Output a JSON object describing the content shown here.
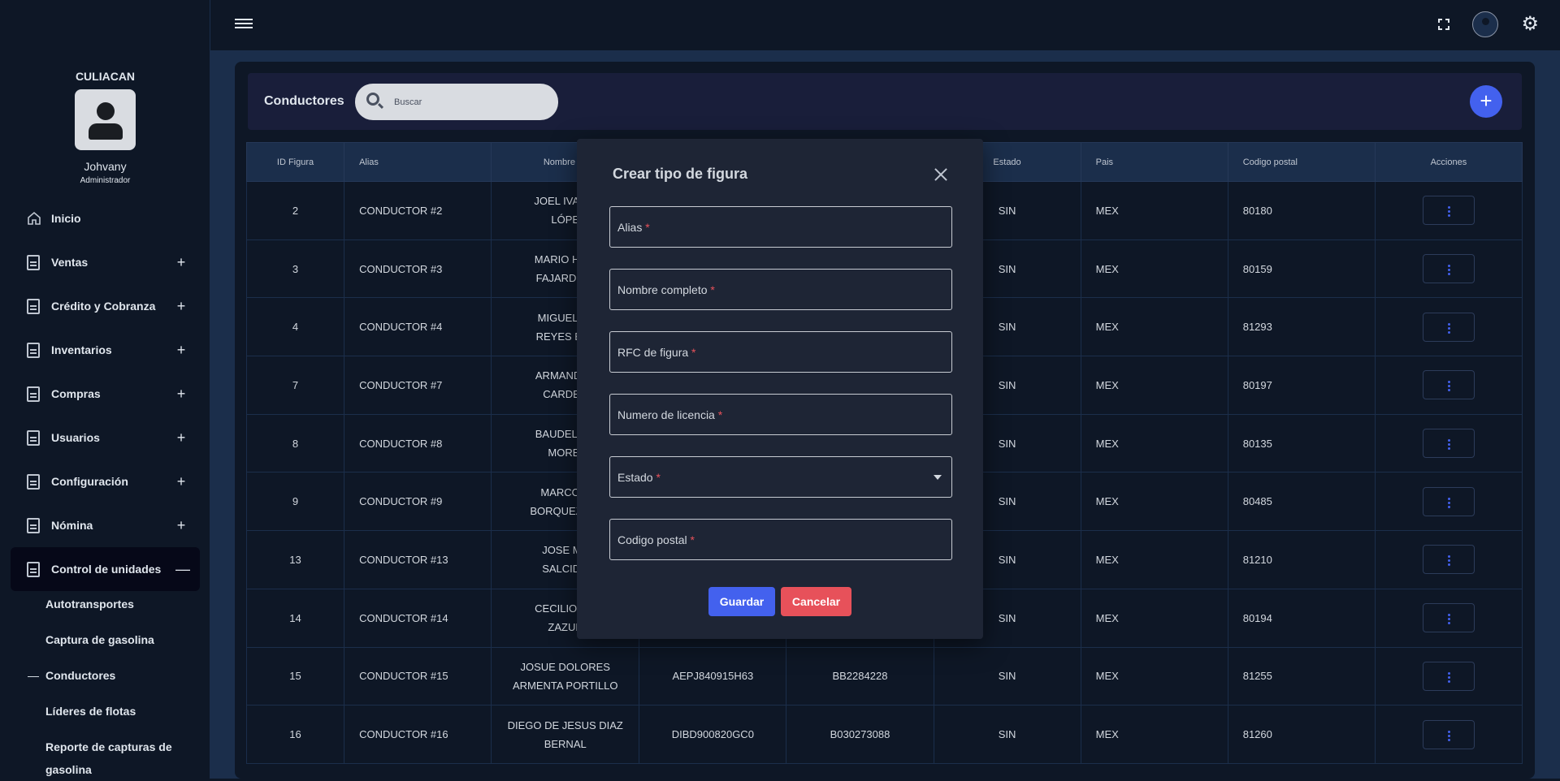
{
  "sidebar": {
    "brand": "CULIACAN",
    "user_name": "Johvany",
    "user_role": "Administrador",
    "items": [
      {
        "label": "Inicio",
        "toggle": ""
      },
      {
        "label": "Ventas",
        "toggle": "+"
      },
      {
        "label": "Crédito y Cobranza",
        "toggle": "+"
      },
      {
        "label": "Inventarios",
        "toggle": "+"
      },
      {
        "label": "Compras",
        "toggle": "+"
      },
      {
        "label": "Usuarios",
        "toggle": "+"
      },
      {
        "label": "Configuración",
        "toggle": "+"
      },
      {
        "label": "Nómina",
        "toggle": "+"
      },
      {
        "label": "Control de unidades",
        "toggle": "—"
      }
    ],
    "subitems": [
      "Autotransportes",
      "Captura de gasolina",
      "Conductores",
      "Líderes de flotas",
      "Reporte de capturas de",
      "gasolina"
    ]
  },
  "header": {
    "title": "Conductores",
    "search_placeholder": "Buscar",
    "add_label": "+"
  },
  "table": {
    "columns": [
      "ID Figura",
      "Alias",
      "Nombre co",
      "Estado",
      "Pais",
      "Codigo postal",
      "Acciones"
    ],
    "rows": [
      {
        "id": "2",
        "alias": "CONDUCTOR #2",
        "name1": "JOEL IVAN A",
        "name2": "LÓPE",
        "rfc": "",
        "lic": "",
        "estado": "SIN",
        "pais": "MEX",
        "cp": "80180"
      },
      {
        "id": "3",
        "alias": "CONDUCTOR #3",
        "name1": "MARIO HUM",
        "name2": "FAJARDO B",
        "rfc": "",
        "lic": "",
        "estado": "SIN",
        "pais": "MEX",
        "cp": "80159"
      },
      {
        "id": "4",
        "alias": "CONDUCTOR #4",
        "name1": "MIGUEL AL",
        "name2": "REYES BAL",
        "rfc": "",
        "lic": "",
        "estado": "SIN",
        "pais": "MEX",
        "cp": "81293"
      },
      {
        "id": "7",
        "alias": "CONDUCTOR #7",
        "name1": "ARMANDO I",
        "name2": "CARDEN",
        "rfc": "",
        "lic": "",
        "estado": "SIN",
        "pais": "MEX",
        "cp": "80197"
      },
      {
        "id": "8",
        "alias": "CONDUCTOR #8",
        "name1": "BAUDEL GA",
        "name2": "MOREI",
        "rfc": "",
        "lic": "",
        "estado": "SIN",
        "pais": "MEX",
        "cp": "80135"
      },
      {
        "id": "9",
        "alias": "CONDUCTOR #9",
        "name1": "MARCO V",
        "name2": "BORQUEZ BO",
        "rfc": "",
        "lic": "",
        "estado": "SIN",
        "pais": "MEX",
        "cp": "80485"
      },
      {
        "id": "13",
        "alias": "CONDUCTOR #13",
        "name1": "JOSE MA",
        "name2": "SALCIDO",
        "rfc": "",
        "lic": "",
        "estado": "SIN",
        "pais": "MEX",
        "cp": "81210"
      },
      {
        "id": "14",
        "alias": "CONDUCTOR #14",
        "name1": "CECILIO QU",
        "name2": "ZAZUE",
        "rfc": "",
        "lic": "",
        "estado": "SIN",
        "pais": "MEX",
        "cp": "80194"
      },
      {
        "id": "15",
        "alias": "CONDUCTOR #15",
        "name1": "JOSUE DOLORES",
        "name2": "ARMENTA PORTILLO",
        "rfc": "AEPJ840915H63",
        "lic": "BB2284228",
        "estado": "SIN",
        "pais": "MEX",
        "cp": "81255"
      },
      {
        "id": "16",
        "alias": "CONDUCTOR #16",
        "name1": "DIEGO DE JESUS DIAZ",
        "name2": "BERNAL",
        "rfc": "DIBD900820GC0",
        "lic": "B030273088",
        "estado": "SIN",
        "pais": "MEX",
        "cp": "81260"
      }
    ]
  },
  "modal": {
    "title": "Crear tipo de figura",
    "fields": [
      {
        "label": "Alias",
        "req": "*"
      },
      {
        "label": "Nombre completo",
        "req": "*"
      },
      {
        "label": "RFC de figura",
        "req": "*"
      },
      {
        "label": "Numero de licencia",
        "req": "*"
      },
      {
        "label": "Estado",
        "req": "*"
      },
      {
        "label": "Codigo postal",
        "req": "*"
      }
    ],
    "save_label": "Guardar",
    "cancel_label": "Cancelar"
  },
  "colors": {
    "primary": "#4361ee",
    "danger": "#e7515a",
    "background": "#0e1726"
  }
}
